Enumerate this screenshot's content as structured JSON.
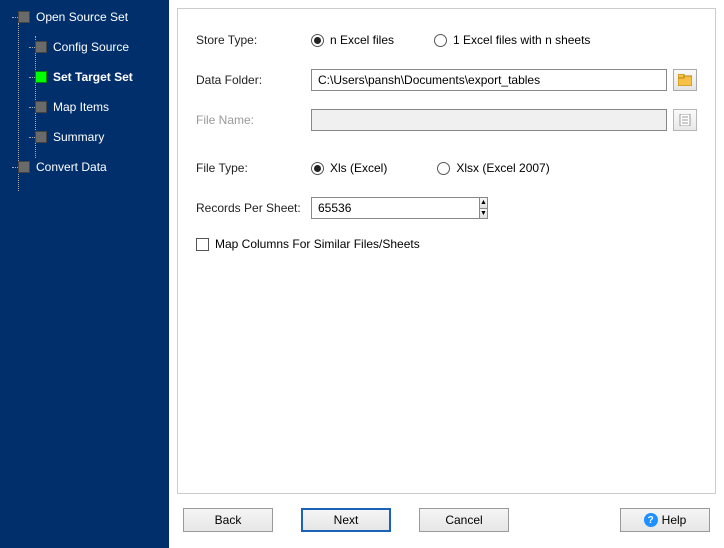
{
  "sidebar": {
    "items": [
      {
        "label": "Open Source Set",
        "level": 0,
        "active": false
      },
      {
        "label": "Config Source",
        "level": 1,
        "active": false
      },
      {
        "label": "Set Target Set",
        "level": 1,
        "active": true
      },
      {
        "label": "Map Items",
        "level": 1,
        "active": false
      },
      {
        "label": "Summary",
        "level": 1,
        "active": false
      },
      {
        "label": "Convert Data",
        "level": 0,
        "active": false
      }
    ]
  },
  "form": {
    "store_type_label": "Store Type:",
    "store_type_options": {
      "n_files": "n Excel files",
      "one_file": "1 Excel files with n sheets"
    },
    "store_type_selected": "n_files",
    "data_folder_label": "Data Folder:",
    "data_folder_value": "C:\\Users\\pansh\\Documents\\export_tables",
    "file_name_label": "File Name:",
    "file_name_value": "",
    "file_type_label": "File Type:",
    "file_type_options": {
      "xls": "Xls (Excel)",
      "xlsx": "Xlsx (Excel 2007)"
    },
    "file_type_selected": "xls",
    "records_label": "Records Per Sheet:",
    "records_value": "65536",
    "map_columns_label": "Map Columns For Similar Files/Sheets",
    "map_columns_checked": false
  },
  "footer": {
    "back": "Back",
    "next": "Next",
    "cancel": "Cancel",
    "help": "Help"
  }
}
